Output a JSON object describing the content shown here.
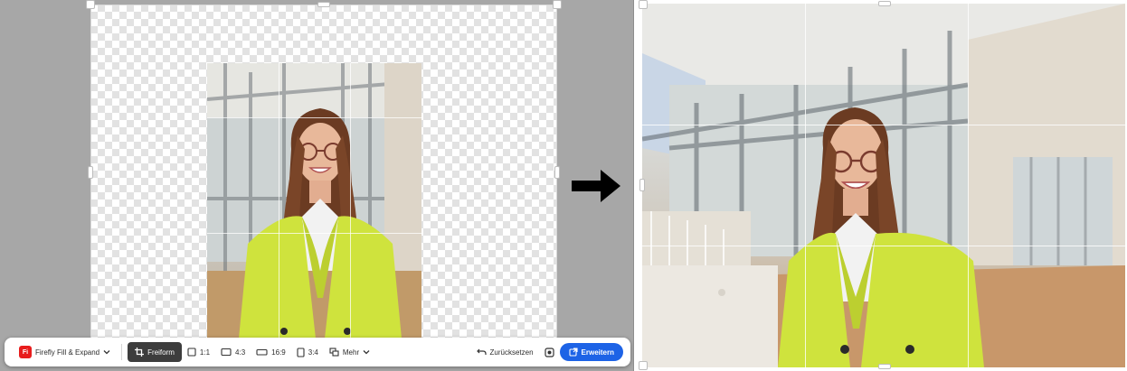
{
  "toolbar": {
    "app_icon_label": "Fi",
    "app_name": "Firefly Fill & Expand",
    "freeform_label": "Freiform",
    "ratio_1_1": "1:1",
    "ratio_4_3": "4:3",
    "ratio_16_9": "16:9",
    "ratio_3_4": "3:4",
    "more_label": "Mehr",
    "reset_label": "Zurücksetzen",
    "expand_label": "Erweitern"
  },
  "icons": {
    "app": "firefly-app-icon",
    "dropdown": "chevron-down-icon",
    "crop": "crop-icon",
    "square": "square-ratio-icon",
    "landscape": "landscape-ratio-icon",
    "portrait": "portrait-ratio-icon",
    "more": "more-shapes-icon",
    "reset": "undo-icon",
    "generate": "generate-icon",
    "expand": "expand-icon",
    "arrow": "arrow-right-icon"
  },
  "colors": {
    "accent": "#1d63e6",
    "active_tool": "#3d3d3d",
    "app_icon": "#e81d1d",
    "jacket": "#cfe33d"
  }
}
